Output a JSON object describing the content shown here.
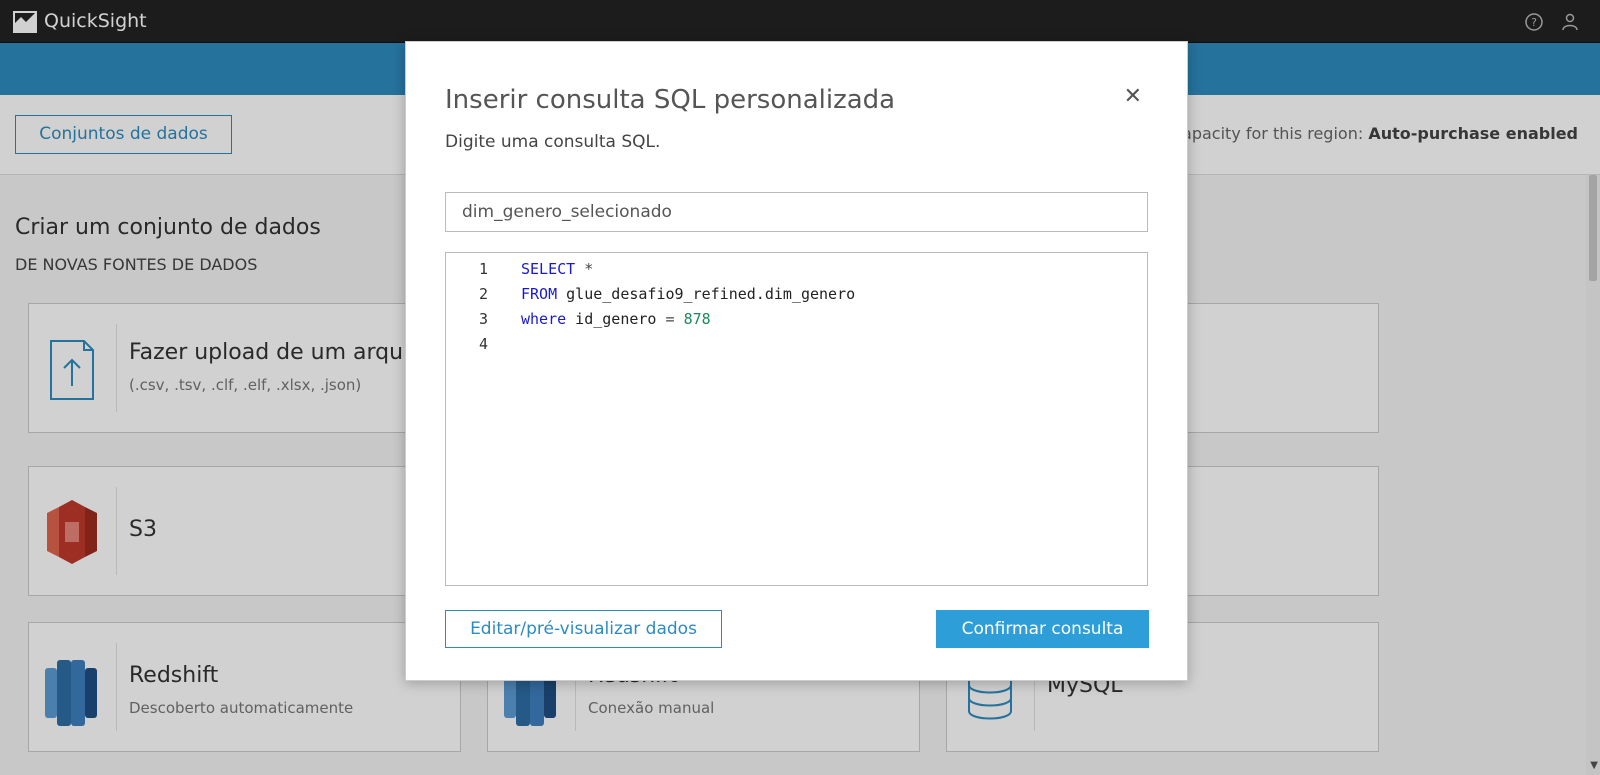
{
  "app": {
    "name": "QuickSight"
  },
  "header_icons": {
    "help": "help-circle-icon",
    "user": "user-icon"
  },
  "subbar": {
    "datasets_button": "Conjuntos de dados",
    "spice_prefix": "apacity for this region: ",
    "spice_status": "Auto-purchase enabled"
  },
  "main": {
    "heading": "Criar um conjunto de dados",
    "subheading": "DE NOVAS FONTES DE DADOS",
    "cards": [
      {
        "title": "Fazer upload de um arqu...",
        "subtitle": "(.csv, .tsv, .clf, .elf, .xlsx, .json)",
        "icon": "upload-file-icon"
      },
      {
        "title": "S3",
        "subtitle": "",
        "icon": "s3-icon"
      },
      {
        "title": "Redshift",
        "subtitle": "Descoberto automaticamente",
        "icon": "redshift-icon"
      },
      {
        "title": "Redshift",
        "subtitle": "Conexão manual",
        "icon": "redshift-icon"
      },
      {
        "title": "MySQL",
        "subtitle": "",
        "icon": "database-icon"
      }
    ]
  },
  "modal": {
    "title": "Inserir consulta SQL personalizada",
    "description": "Digite uma consulta SQL.",
    "query_name": "dim_genero_selecionado",
    "code_lines": [
      {
        "num": "1",
        "parts": [
          {
            "t": "SELECT",
            "c": "kw"
          },
          {
            "t": " *",
            "c": "op"
          }
        ]
      },
      {
        "num": "2",
        "parts": [
          {
            "t": "FROM",
            "c": "kw"
          },
          {
            "t": " glue_desafio9_refined.dim_genero",
            "c": ""
          }
        ]
      },
      {
        "num": "3",
        "parts": [
          {
            "t": "where",
            "c": "kw"
          },
          {
            "t": " id_genero ",
            "c": ""
          },
          {
            "t": "=",
            "c": "op"
          },
          {
            "t": " ",
            "c": ""
          },
          {
            "t": "878",
            "c": "num"
          }
        ]
      },
      {
        "num": "4",
        "parts": []
      }
    ],
    "edit_button": "Editar/pré-visualizar dados",
    "confirm_button": "Confirmar consulta"
  },
  "colors": {
    "accent": "#2e8bbf",
    "primary_button": "#2e9ed8",
    "topbar": "#232323"
  }
}
